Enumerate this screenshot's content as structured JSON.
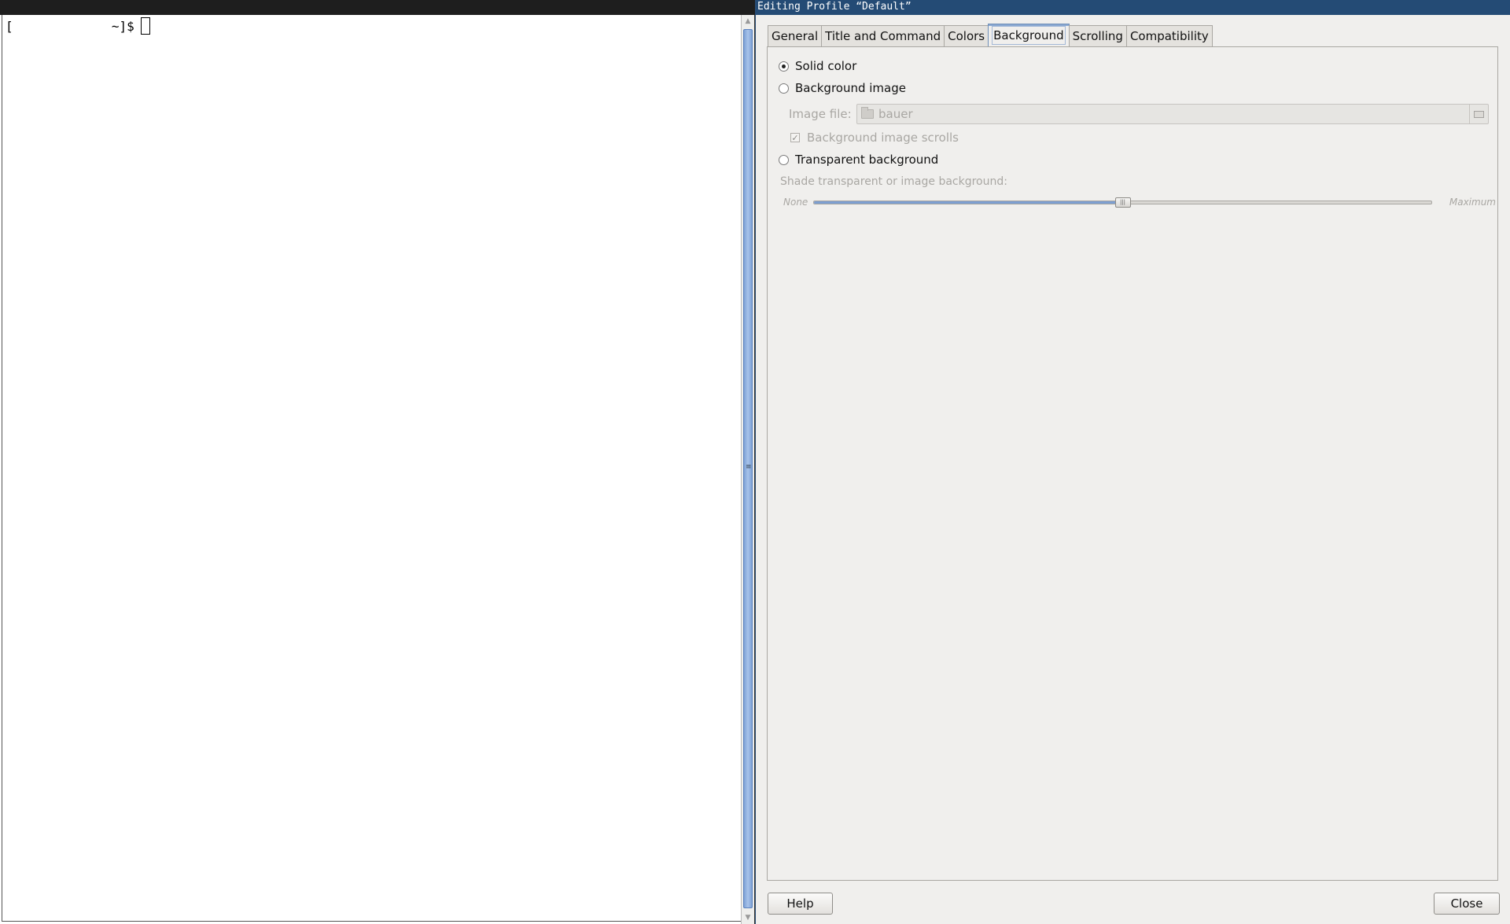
{
  "terminal": {
    "prompt": "[             ~]$"
  },
  "dialog": {
    "title": "Editing Profile “Default”",
    "tabs": [
      {
        "label": "General"
      },
      {
        "label": "Title and Command"
      },
      {
        "label": "Colors"
      },
      {
        "label": "Background",
        "active": true
      },
      {
        "label": "Scrolling"
      },
      {
        "label": "Compatibility"
      }
    ],
    "background": {
      "solid_color_label": "Solid color",
      "solid_color_selected": true,
      "background_image_label": "Background image",
      "image_file_label": "Image file:",
      "image_file_value": "bauer",
      "image_scrolls_label": "Background image scrolls",
      "image_scrolls_checked": true,
      "transparent_label": "Transparent background",
      "shade_label": "Shade transparent or image background:",
      "shade_min_label": "None",
      "shade_max_label": "Maximum",
      "shade_value_fraction": 0.5
    },
    "help_label": "Help",
    "close_label": "Close"
  },
  "colors": {
    "dialog_titlebar": "#244b75",
    "accent": "#7d9fd1",
    "disabled_text": "#a9a7a3"
  }
}
